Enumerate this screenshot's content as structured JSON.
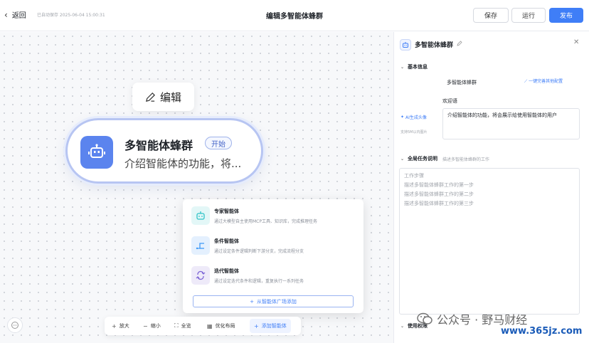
{
  "topbar": {
    "back_label": "返回",
    "autosave": "已自动保存 2025-06-04 15:00:31",
    "title": "编辑多智能体蜂群",
    "save_label": "保存",
    "run_label": "运行",
    "publish_label": "发布"
  },
  "canvas": {
    "edit_label": "编辑",
    "agent": {
      "name": "多智能体蜂群",
      "badge": "开始",
      "desc": "介绍智能体的功能，将..."
    },
    "menu": {
      "items": [
        {
          "title": "专家智能体",
          "desc": "通过大模型自主使用MCP工具、知识库，完成推理任务",
          "icon": "robot-icon",
          "color": "#2fc3c7"
        },
        {
          "title": "条件智能体",
          "desc": "通过设定条件逻辑判断下游分支，完成流程分支",
          "icon": "branch-icon",
          "color": "#3f9af7"
        },
        {
          "title": "迭代智能体",
          "desc": "通过设定迭代条件和逻辑，重复执行一系列任务",
          "icon": "loop-icon",
          "color": "#7b63d6"
        }
      ],
      "add_label": "从智能体广场添加"
    },
    "toolbar": {
      "zoom_in": "放大",
      "zoom_out": "缩小",
      "fit": "全览",
      "layout": "优化布局",
      "add_agent": "添加智能体"
    }
  },
  "panel": {
    "title": "多智能体蜂群",
    "basic_section": "基本信息",
    "name_value": "多智能体蜂群",
    "one_click_label": "一键完善其他配置",
    "welcome_label": "欢迎语",
    "ai_avatar_label": "AI生成头像",
    "support_hint": "支持5M以内图片",
    "welcome_value": "介绍智能体的功能，将会展示给使用智能体的用户",
    "task_section": "全局任务说明",
    "task_hint": "描述多智能体蜂群的工作",
    "task_lines": [
      "工作步骤",
      "描述多智能体蜂群工作的第一步",
      "描述多智能体蜂群工作的第二步",
      "描述多智能体蜂群工作的第三步"
    ],
    "permission_section": "使用权限"
  },
  "watermark": {
    "line1": "公众号 · 野马财经",
    "line2": "www.365jz.com"
  },
  "colors": {
    "accent": "#3f7ef7",
    "agent_avatar": "#5b84ee"
  }
}
